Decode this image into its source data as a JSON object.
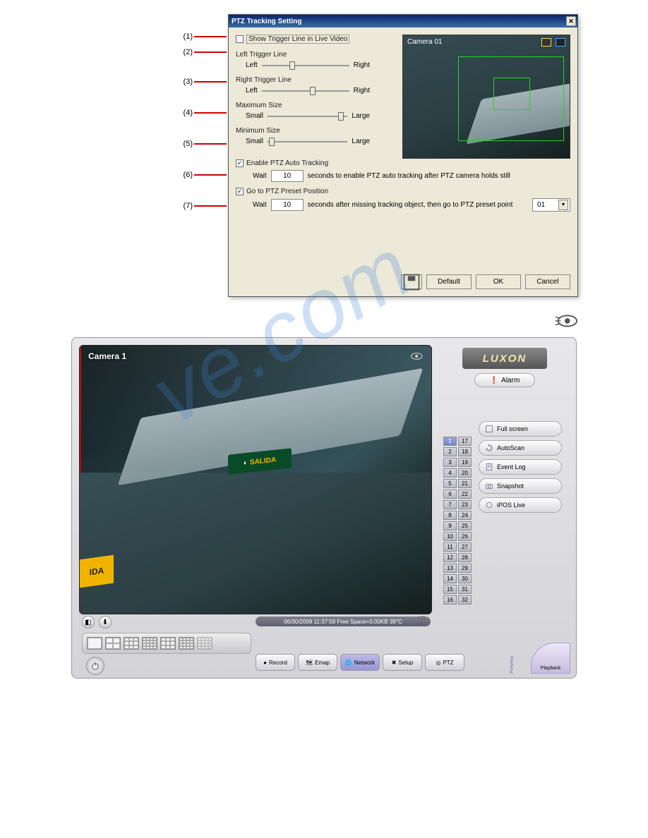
{
  "dialog": {
    "title": "PTZ Tracking Setting",
    "show_trigger_label": "Show Trigger Line in Live Video",
    "left_trigger_label": "Left Trigger Line",
    "right_trigger_label": "Right Trigger Line",
    "left_text": "Left",
    "right_text": "Right",
    "max_size_label": "Maximum Size",
    "min_size_label": "Minimum Size",
    "small_text": "Small",
    "large_text": "Large",
    "enable_label": "Enable PTZ Auto Tracking",
    "wait_label": "Wait",
    "wait1_value": "10",
    "wait1_suffix": "seconds to enable PTZ auto tracking after PTZ camera holds still",
    "goto_label": "Go to PTZ Preset Position",
    "wait2_value": "10",
    "wait2_suffix": "seconds after missing tracking object, then go to PTZ preset point",
    "preset_value": "01",
    "preview_cam": "Camera 01",
    "btn_default": "Default",
    "btn_ok": "OK",
    "btn_cancel": "Cancel",
    "annotations": {
      "a1": "(1)",
      "a2": "(2)",
      "a3": "(3)",
      "a4": "(4)",
      "a5": "(5)",
      "a6": "(6)",
      "a7": "(7)"
    }
  },
  "watermark": "ve.com",
  "dvr": {
    "logo": "LUXON",
    "alarm": "Alarm",
    "camera_label": "Camera 1",
    "status": "06/30/2009 11:37:59   Free Space=0.00KB 39°C",
    "scene_sign": "SALIDA",
    "scene_yellow": "IDA",
    "rbtns": {
      "fullscreen": "Full screen",
      "autoscan": "AutoScan",
      "eventlog": "Event Log",
      "snapshot": "Snapshot",
      "ipos": "iPOS Live"
    },
    "tabs": {
      "record": "Record",
      "emap": "Emap",
      "network": "Network",
      "setup": "Setup",
      "ptz": "PTZ"
    },
    "playback": "Playback",
    "preview": "Preview",
    "cam_numbers": [
      "1",
      "17",
      "2",
      "18",
      "3",
      "19",
      "4",
      "20",
      "5",
      "21",
      "6",
      "22",
      "7",
      "23",
      "8",
      "24",
      "9",
      "25",
      "10",
      "26",
      "11",
      "27",
      "12",
      "28",
      "13",
      "29",
      "14",
      "30",
      "15",
      "31",
      "16",
      "32"
    ]
  }
}
